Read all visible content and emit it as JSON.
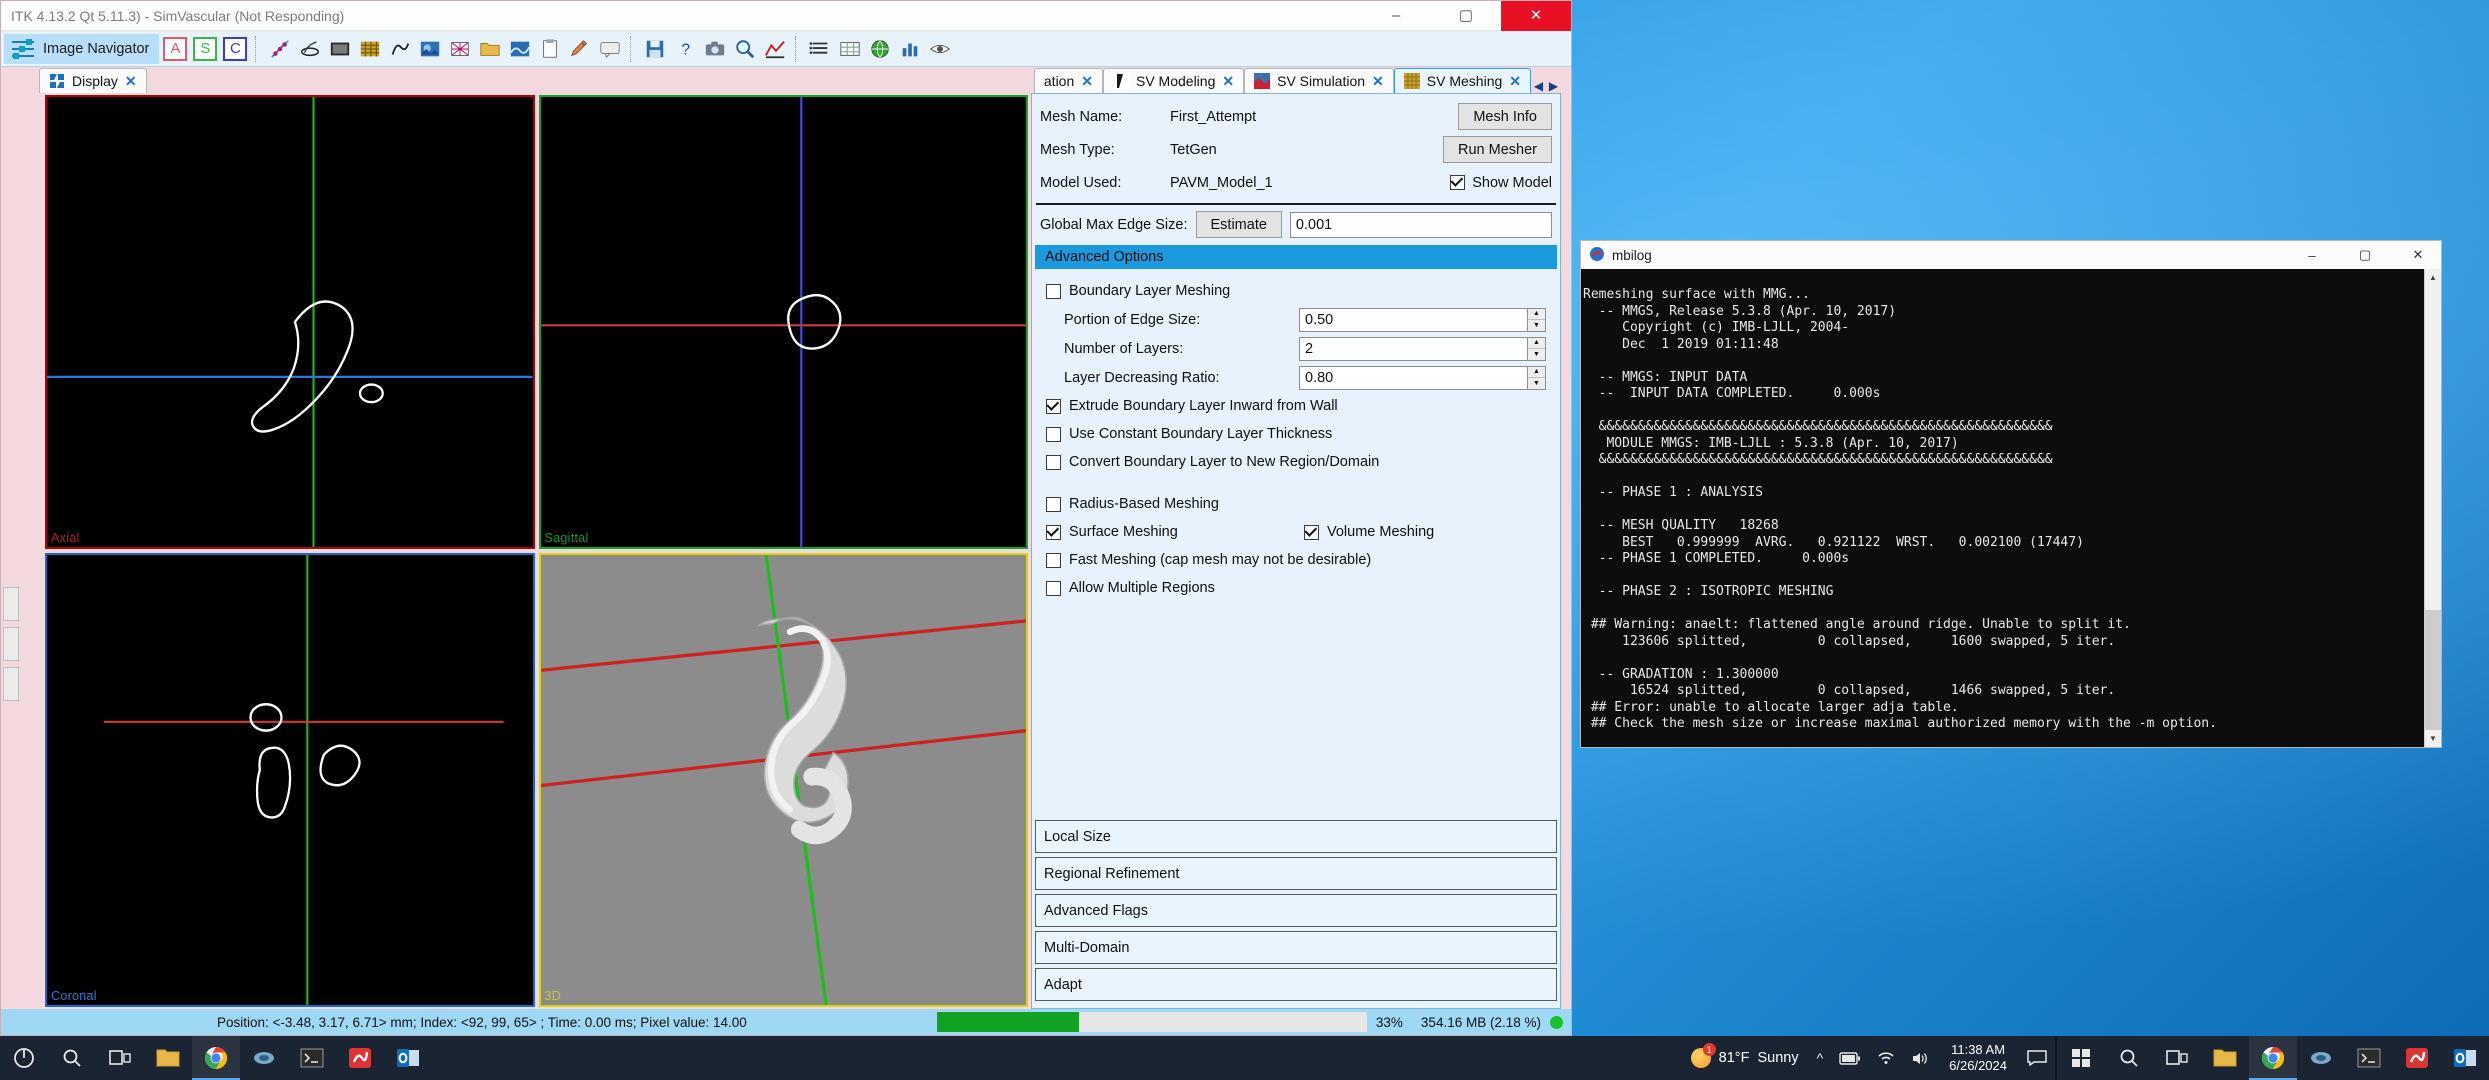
{
  "window": {
    "title": "ITK 4.13.2 Qt 5.11.3) - SimVascular (Not Responding)",
    "minimize": "–",
    "maximize": "▢",
    "close": "✕"
  },
  "toolbar": {
    "image_navigator": "Image Navigator",
    "plane_a": "A",
    "plane_s": "S",
    "plane_c": "C",
    "icons": [
      "measurement-icon",
      "segmentation-icon",
      "image-stack-icon",
      "texture-icon",
      "path-icon",
      "model-icon",
      "mesh-icon",
      "simulation-icon",
      "folder-icon",
      "clipboard-icon",
      "annotation-icon",
      "pencil-icon",
      "save-icon",
      "window-icon",
      "help-icon",
      "camera-icon",
      "zoom-icon",
      "colormap-icon",
      "list-icon",
      "table-icon",
      "globe-icon",
      "chart-icon",
      "eye-icon"
    ]
  },
  "left_tabs": [
    {
      "label": "Display",
      "icon": "display-icon",
      "close": "✕",
      "selected": true
    }
  ],
  "right_tabs": [
    {
      "label": "ation",
      "icon": "segmentation-icon",
      "close": "✕",
      "selected": false
    },
    {
      "label": "SV Modeling",
      "icon": "modeling-icon",
      "close": "✕",
      "selected": false
    },
    {
      "label": "SV Simulation",
      "icon": "simulation-icon",
      "close": "✕",
      "selected": false
    },
    {
      "label": "SV Meshing",
      "icon": "meshing-icon",
      "close": "✕",
      "selected": true
    }
  ],
  "tab_nav": {
    "prev": "◀",
    "next": "▶"
  },
  "viewports": [
    {
      "name": "Axial",
      "label": "Axial",
      "color": "#b00000"
    },
    {
      "name": "Sagittal",
      "label": "Sagittal",
      "color": "#0aa82e"
    },
    {
      "name": "Coronal",
      "label": "Coronal",
      "color": "#1769d6"
    },
    {
      "name": "3D",
      "label": "3D",
      "color": "#d8d800"
    }
  ],
  "mesh_panel": {
    "mesh_name_label": "Mesh Name:",
    "mesh_name_value": "First_Attempt",
    "mesh_type_label": "Mesh Type:",
    "mesh_type_value": "TetGen",
    "model_used_label": "Model Used:",
    "model_used_value": "PAVM_Model_1",
    "mesh_info_button": "Mesh Info",
    "run_mesher_button": "Run Mesher",
    "show_model_label": "Show Model",
    "show_model_checked": true,
    "global_max_edge_label": "Global Max Edge Size:",
    "estimate_button": "Estimate",
    "global_max_edge_value": "0.001",
    "advanced_options_title": "Advanced Options",
    "checkboxes": [
      {
        "label": "Boundary Layer Meshing",
        "checked": false
      },
      {
        "label": "Extrude Boundary Layer Inward from Wall",
        "checked": true
      },
      {
        "label": "Use Constant Boundary Layer Thickness",
        "checked": false
      },
      {
        "label": "Convert Boundary Layer to New Region/Domain",
        "checked": false
      },
      {
        "label": "Radius-Based Meshing",
        "checked": false
      },
      {
        "label": "Surface Meshing",
        "checked": true
      },
      {
        "label": "Volume Meshing",
        "checked": true
      },
      {
        "label": "Fast Meshing (cap mesh may not be desirable)",
        "checked": false
      },
      {
        "label": "Allow Multiple Regions",
        "checked": false
      }
    ],
    "spinners": [
      {
        "label": "Portion of Edge Size:",
        "value": "0.50"
      },
      {
        "label": "Number of Layers:",
        "value": "2"
      },
      {
        "label": "Layer Decreasing Ratio:",
        "value": "0.80"
      }
    ],
    "collapsed_sections": [
      "Local Size",
      "Regional Refinement",
      "Advanced Flags",
      "Multi-Domain",
      "Adapt"
    ]
  },
  "statusbar": {
    "position_text": "Position: <-3.48, 3.17, 6.71> mm; Index: <92, 99, 65> ; Time: 0.00 ms; Pixel value: 14.00",
    "progress_percent": "33%",
    "progress_value": 33,
    "memory": "354.16 MB (2.18 %)"
  },
  "mbilog": {
    "title": "mbilog",
    "minimize": "–",
    "maximize": "▢",
    "close": "✕",
    "log": "Remeshing surface with MMG...\n  -- MMGS, Release 5.3.8 (Apr. 10, 2017)\n     Copyright (c) IMB-LJLL, 2004-\n     Dec  1 2019 01:11:48\n\n  -- MMGS: INPUT DATA\n  --  INPUT DATA COMPLETED.     0.000s\n\n  &&&&&&&&&&&&&&&&&&&&&&&&&&&&&&&&&&&&&&&&&&&&&&&&&&&&&&&&&&\n   MODULE MMGS: IMB-LJLL : 5.3.8 (Apr. 10, 2017)\n  &&&&&&&&&&&&&&&&&&&&&&&&&&&&&&&&&&&&&&&&&&&&&&&&&&&&&&&&&&\n\n  -- PHASE 1 : ANALYSIS\n\n  -- MESH QUALITY   18268\n     BEST   0.999999  AVRG.   0.921122  WRST.   0.002100 (17447)\n  -- PHASE 1 COMPLETED.     0.000s\n\n  -- PHASE 2 : ISOTROPIC MESHING\n\n ## Warning: anaelt: flattened angle around ridge. Unable to split it.\n     123606 splitted,         0 collapsed,     1600 swapped, 5 iter.\n\n  -- GRADATION : 1.300000\n      16524 splitted,         0 collapsed,     1466 swapped, 5 iter.\n ## Error: unable to allocate larger adja table.\n ## Check the mesh size or increase maximal authorized memory with the -m option.\n ## Check the mesh size or increase maximal authorized memory with the -m option."
  },
  "taskbar": {
    "start": "start-icon",
    "search": "search-icon",
    "taskview": "task-view-icon",
    "apps": [
      "file-explorer-icon",
      "chrome-icon",
      "paraview-icon",
      "terminal-icon",
      "simvascular-icon",
      "outlook-icon"
    ],
    "weather_temp": "81°F",
    "weather_cond": "Sunny",
    "time": "11:38 AM",
    "date": "6/26/2024",
    "tray": [
      "chevron-up-icon",
      "battery-icon",
      "wifi-icon",
      "volume-icon"
    ],
    "notification": "notification-icon"
  },
  "colors": {
    "panel_bg": "#e7f2fc",
    "section_header": "#1b9ae0",
    "window_frame": "#f3d9dd",
    "accent": "#1f6fd0",
    "progress": "#13a324"
  }
}
